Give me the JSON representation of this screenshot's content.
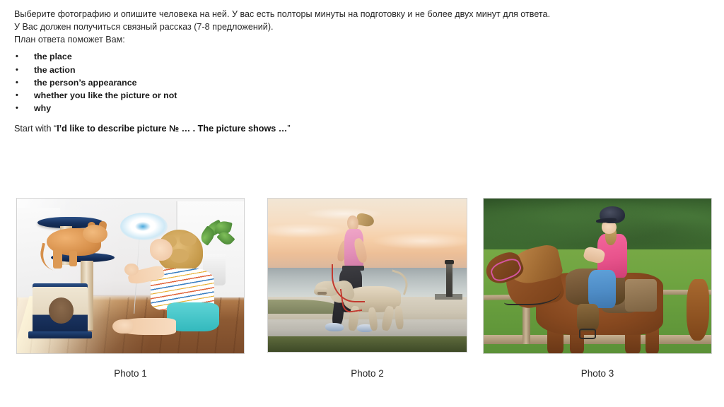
{
  "slide": {
    "title_lines": [
      "Выберите фотографию и опишите человека на ней. У вас есть полторы минуты на подготовку и не более двух минут для ответа.",
      "У Вас должен получиться связный рассказ (7-8 предложений).",
      "План ответа поможет Вам:"
    ],
    "plan_bullet": "•",
    "plan_items": [
      "the place",
      "the action",
      "the person’s appearance",
      "whether you like the picture or not",
      "why"
    ],
    "start_prefix": "Start with “",
    "start_bold": "I’d like to describe picture № … . The picture shows …",
    "start_suffix": "”"
  },
  "photos": [
    {
      "caption": "Photo 1",
      "alt": "A little blond boy sitting on a wooden floor playing with a ginger cat on a navy and cream cat tree, holding a white and blue feather wand toy",
      "scene": "indoor-living-room"
    },
    {
      "caption": "Photo 2",
      "alt": "A woman in a pink tank top and black leggings jogging along a seaside path at sunset with a tan dog on a red leash",
      "scene": "beach-path-sunset"
    },
    {
      "caption": "Photo 3",
      "alt": "A girl in a pink shirt, blue jeans, boots and a dark riding helmet sitting on a chestnut horse with a pink halter in a green field",
      "scene": "green-field-horse"
    }
  ],
  "colors": {
    "background": "#ffffff",
    "text": "#262626",
    "bold_text": "#1a1a1a"
  }
}
